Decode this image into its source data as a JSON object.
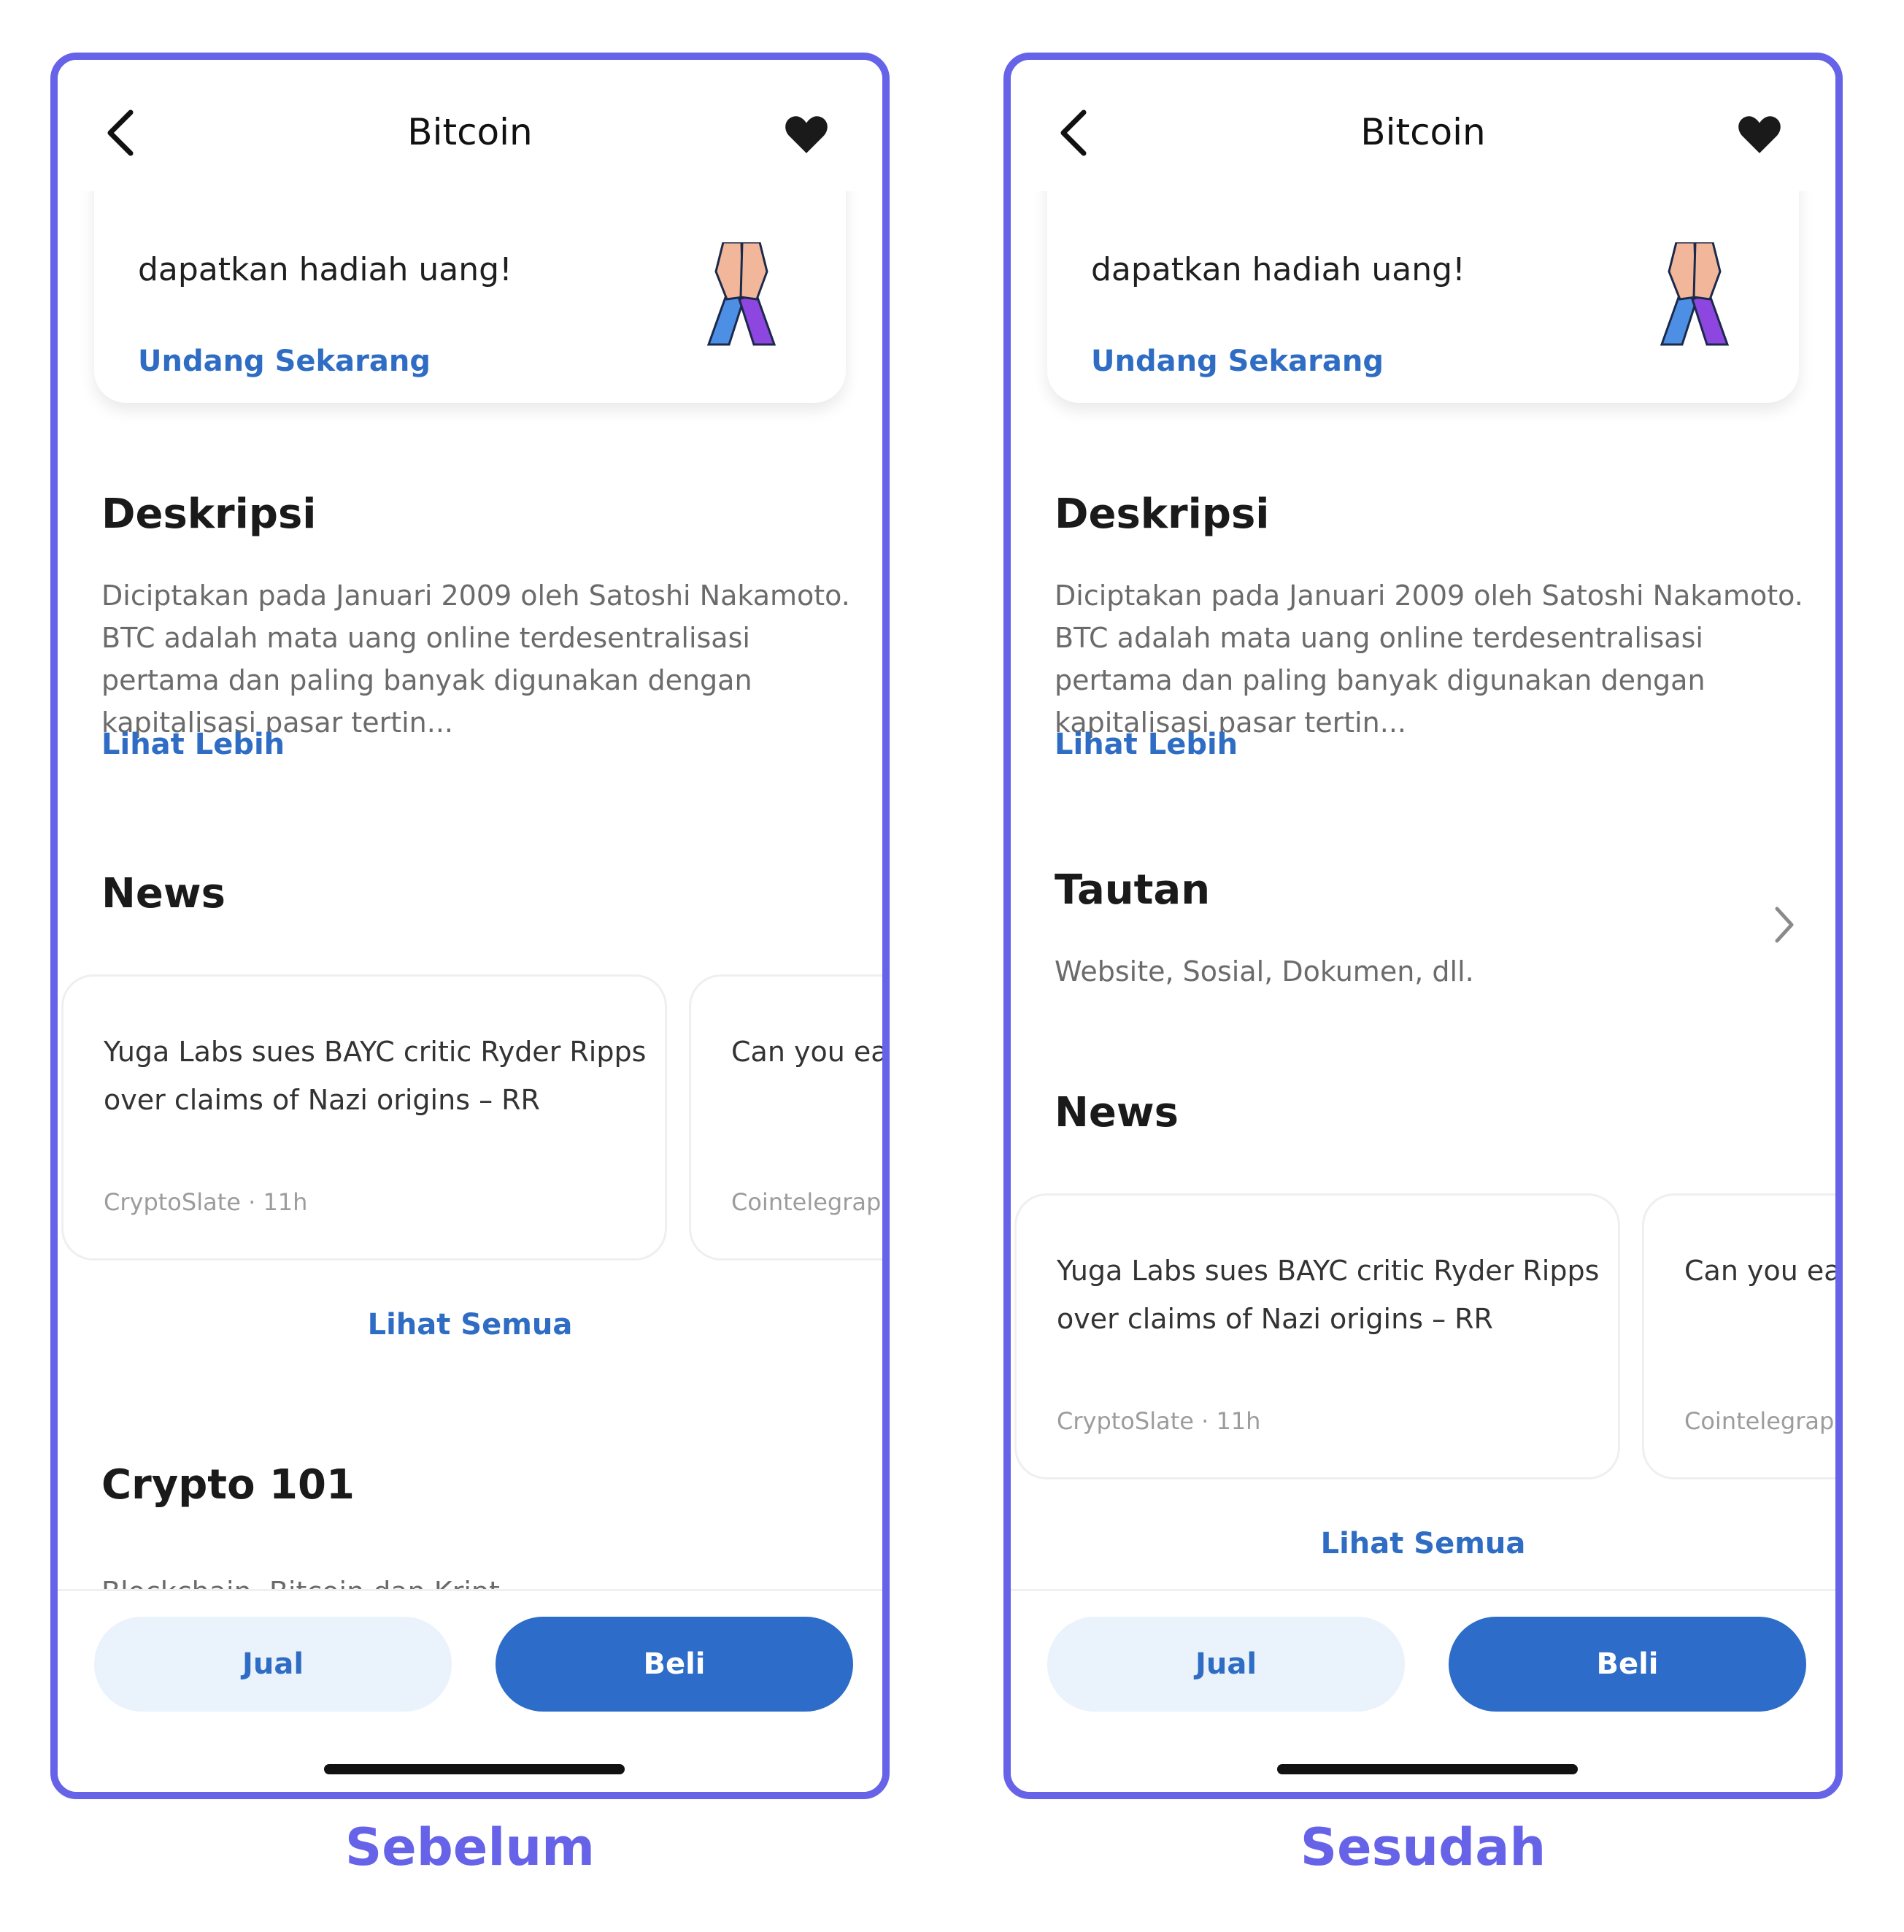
{
  "screen": {
    "title": "Bitcoin",
    "invite": {
      "text": "dapatkan hadiah uang!",
      "link": "Undang Sekarang"
    },
    "description": {
      "heading": "Deskripsi",
      "text": "Diciptakan pada Januari 2009 oleh Satoshi Nakamoto. BTC adalah mata uang online terdesentralisasi pertama dan paling banyak digunakan dengan kapitalisasi pasar tertin...",
      "more_link": "Lihat Lebih"
    },
    "links_section": {
      "heading": "Tautan",
      "subtitle": "Website, Sosial, Dokumen, dll."
    },
    "news": {
      "heading": "News",
      "items": [
        {
          "title": "Yuga Labs sues BAYC critic Ryder Ripps over claims of Nazi origins – RR",
          "meta": "CryptoSlate · 11h"
        },
        {
          "title": "Can you ear Lightning nc",
          "meta": "Cointelegraph"
        }
      ],
      "see_all": "Lihat Semua"
    },
    "crypto101": {
      "heading": "Crypto 101",
      "partial_text": "Blockchain, Bitcoin dan Kript"
    },
    "actions": {
      "sell": "Jual",
      "buy": "Beli"
    }
  },
  "captions": {
    "before": "Sebelum",
    "after": "Sesudah"
  },
  "colors": {
    "frame": "#6663E8",
    "accent": "#2F6DC4",
    "buy_button": "#2D6CC8",
    "sell_button_bg": "#EAF2FB"
  },
  "icons": [
    "back-chevron-icon",
    "heart-icon",
    "praying-hands-icon",
    "chevron-right-icon"
  ]
}
